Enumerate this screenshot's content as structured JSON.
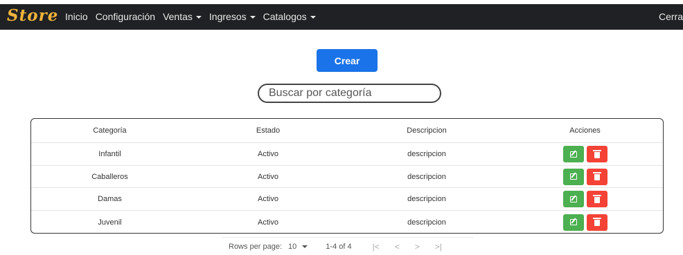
{
  "navbar": {
    "brand": "Store",
    "items": [
      {
        "label": "Inicio",
        "dropdown": false
      },
      {
        "label": "Configuración",
        "dropdown": false
      },
      {
        "label": "Ventas",
        "dropdown": true
      },
      {
        "label": "Ingresos",
        "dropdown": true
      },
      {
        "label": "Catalogos",
        "dropdown": true
      }
    ],
    "right_label": "Cerra"
  },
  "actions": {
    "create_label": "Crear"
  },
  "search": {
    "placeholder": "Buscar por categoría",
    "value": ""
  },
  "table": {
    "headers": [
      "Categoría",
      "Estado",
      "Descripcion",
      "Acciones"
    ],
    "rows": [
      {
        "categoria": "Infantil",
        "estado": "Activo",
        "descripcion": "descripcion"
      },
      {
        "categoria": "Caballeros",
        "estado": "Activo",
        "descripcion": "descripcion"
      },
      {
        "categoria": "Damas",
        "estado": "Activo",
        "descripcion": "descripcion"
      },
      {
        "categoria": "Juvenil",
        "estado": "Activo",
        "descripcion": "descripcion"
      }
    ]
  },
  "pagination": {
    "rows_per_page_label": "Rows per page:",
    "rows_per_page_value": "10",
    "range": "1-4 of 4",
    "first": "|<",
    "prev": "<",
    "next": ">",
    "last": ">|"
  },
  "colors": {
    "navbar_bg": "#202124",
    "brand": "#f0b43a",
    "primary": "#1a73e8",
    "edit": "#4caf50",
    "delete": "#f44336"
  }
}
